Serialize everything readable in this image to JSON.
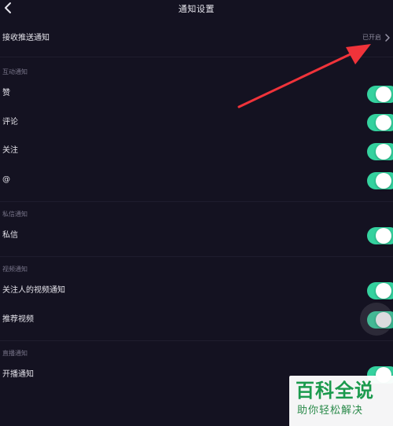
{
  "header": {
    "title": "通知设置"
  },
  "receive_push": {
    "label": "接收推送通知",
    "status": "已开启"
  },
  "sections": {
    "interaction": {
      "title": "互动通知",
      "items": [
        {
          "label": "赞",
          "enabled": true
        },
        {
          "label": "评论",
          "enabled": true
        },
        {
          "label": "关注",
          "enabled": true
        },
        {
          "label": "@",
          "enabled": true
        }
      ]
    },
    "private_message": {
      "title": "私信通知",
      "items": [
        {
          "label": "私信",
          "enabled": true
        }
      ]
    },
    "video": {
      "title": "视频通知",
      "items": [
        {
          "label": "关注人的视频通知",
          "enabled": true
        },
        {
          "label": "推荐视频",
          "enabled": true
        }
      ]
    },
    "live": {
      "title": "直播通知",
      "items": [
        {
          "label": "开播通知",
          "enabled": true
        }
      ]
    }
  },
  "watermark": {
    "line1": "百科全说",
    "line2": "助你轻松解决"
  },
  "colors": {
    "background": "#141221",
    "toggle_on": "#35d29f",
    "annotation_arrow": "#f0333a",
    "watermark_green": "#1b9a4d"
  }
}
